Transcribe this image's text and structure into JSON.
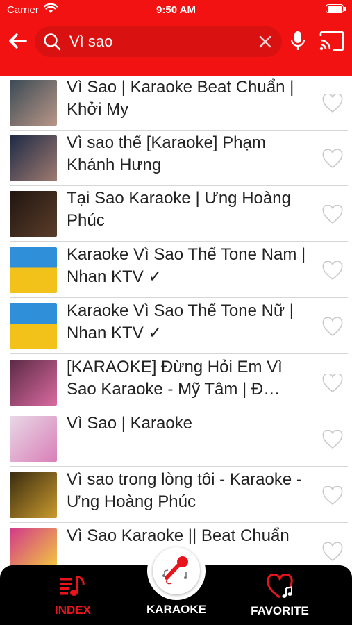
{
  "status_bar": {
    "carrier": "Carrier",
    "time": "9:50 AM"
  },
  "search": {
    "value": "Vì sao"
  },
  "results": [
    {
      "title": "Vì Sao | Karaoke Beat Chuẩn | Khởi My",
      "thumb_colors": [
        "#3a4a55",
        "#b99687"
      ]
    },
    {
      "title": "Vì sao thế [Karaoke] Phạm Khánh Hưng",
      "thumb_colors": [
        "#1d2a45",
        "#a07a70"
      ]
    },
    {
      "title": "Tại Sao Karaoke | Ưng Hoàng Phúc",
      "thumb_colors": [
        "#20150f",
        "#5a3d2a"
      ]
    },
    {
      "title": "Karaoke Vì Sao Thế Tone Nam | Nhan KTV ✓",
      "thumb_colors": [
        "#2f8fd8",
        "#f2c21b"
      ]
    },
    {
      "title": "Karaoke Vì Sao Thế Tone Nữ | Nhan KTV ✓",
      "thumb_colors": [
        "#2f8fd8",
        "#f2c21b"
      ]
    },
    {
      "title": "[KARAOKE] Đừng Hỏi Em Vì Sao Karaoke - Mỹ Tâm | Đ…",
      "thumb_colors": [
        "#5b2a44",
        "#d96aa0"
      ]
    },
    {
      "title": "Vì Sao | Karaoke",
      "thumb_colors": [
        "#e8d8e6",
        "#d97fb8"
      ]
    },
    {
      "title": "Vì sao trong lòng tôi - Karaoke - Ưng Hoàng Phúc",
      "thumb_colors": [
        "#3a2c10",
        "#c99a2e"
      ]
    },
    {
      "title": "Vì Sao Karaoke || Beat Chuẩn",
      "thumb_colors": [
        "#d23a8a",
        "#f5d23a"
      ]
    }
  ],
  "tabs": {
    "index": {
      "label": "INDEX",
      "color": "#e8141c"
    },
    "karaoke": {
      "label": "KARAOKE",
      "color": "#ffffff"
    },
    "favorite": {
      "label": "FAVORITE",
      "color": "#ffffff"
    }
  },
  "colors": {
    "brand": "#f31212",
    "tabbar": "#000000"
  },
  "icons": [
    "back-arrow-icon",
    "search-icon",
    "clear-icon",
    "microphone-icon",
    "cast-icon",
    "heart-icon",
    "music-list-icon",
    "karaoke-mic-icon",
    "heart-music-icon"
  ]
}
